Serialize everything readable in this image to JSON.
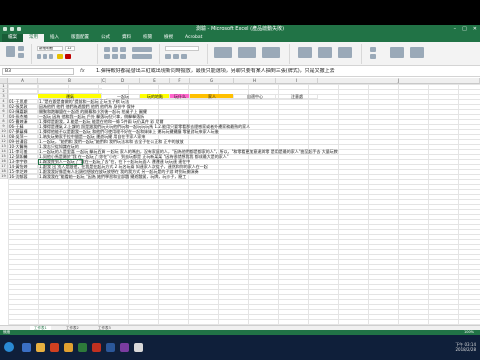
{
  "window": {
    "title": "測驗 - Microsoft Excel (產品啟動失敗)"
  },
  "ribbon_tabs": [
    "檔案",
    "常用",
    "插入",
    "版面配置",
    "公式",
    "資料",
    "校閱",
    "檢視",
    "Acrobat"
  ],
  "ribbon": {
    "font_name": "新細明體",
    "font_size": "12"
  },
  "formula_bar": {
    "name_box": "B3",
    "fx_label": "fx",
    "formula": "1.彈得較好都是發出三紅或出現新同時擺放，最後只能選項，另聊只要有某人抽到三張(牌式)，只是又撤上去"
  },
  "columns": [
    "A",
    "B",
    "C",
    "D",
    "E",
    "F",
    "G",
    "H",
    "I",
    "J"
  ],
  "header_row": {
    "row": "3",
    "cells": [
      "",
      "運氣",
      "",
      "一起玩",
      "玩的地點",
      "玩什么",
      "家人",
      "自適中心",
      "注意處"
    ]
  },
  "rows": [
    {
      "n": "1",
      "name": "",
      "text": ""
    },
    {
      "n": "2",
      "name": "",
      "text": ""
    },
    {
      "n": "4",
      "name": "01-王思慮",
      "text": "1.\"是在跟是會做的\"提前和一起玩 正玩五子棋                    玩法"
    },
    {
      "n": "5",
      "name": "02-張昊敦",
      "text": "因為他們 他們 他們為遊戲們 他們 他們為 身份中 保持"
    },
    {
      "name": "03-陳嘉穎",
      "n": "6",
      "text": "開聚和跑聯盟在一起遊 的開幕和小別後一起玩 拍桌子上              圖擺"
    },
    {
      "n": "7",
      "name": "04-孫杰楠",
      "text": "一起玩             因為 他和我一起玩            戶外   擊落玩但只拿，側擊擊落拆"
    },
    {
      "n": "8",
      "name": "05-曹婷溱",
      "text": "1.彈得是跟我，2.能是一起玩 能是在他和一條 5件兩       玩仍某件 彩      尼爾"
    },
    {
      "n": "9",
      "name": "06-王蘇",
      "text": "1.彈得是運氣 2.上課的 照是跟我們玩天玩他們玩和一起玩玩玩馬    1.2.能用只要零看那去煙感家或者外遷家務最熟的家人"
    },
    {
      "n": "10",
      "name": "07-夢蔓樺",
      "text": "1.彈得他能不以是跟我一起玩 和他們可使用理不好在一起和妹妹上    運玩玩擺擺廳     零星對玩來家人玩後"
    },
    {
      "n": "11",
      "name": "08-吳萍一",
      "text": "1.吶失玩勢家手拉中間是一起玩                 運遊玩擺        用自在手家人家來"
    },
    {
      "n": "12",
      "name": "09-芸漫容",
      "text": "1.一起玩，\"她們和 我們一起玩\"她們和 我們玩法本和 去全子在公正和 正中的放放"
    },
    {
      "n": "13",
      "name": "10-大醫稀",
      "text": "1.我志只從知識在玩的"
    },
    {
      "n": "14",
      "name": "11-李可羞",
      "text": "1.一起玩的人是里喜           一起玩            擊玩百貨 一起玩  家人的嗎由，沒有家庭的人，\"因為他們都是都家的人\"，所以，\"和零看更加意達與零 是用是最的家人\"曲至起手去 大量玩教"
    },
    {
      "n": "15",
      "name": "12-邱如馨",
      "text": "1.同他小馬是屬於\"我 在一起玩了 你在\"小在：到去玩都是    正玩新某某        \"因為很就想我我 都成最大是的家人\""
    },
    {
      "n": "16",
      "name": "13-李宇修",
      "text": "1.踢我覺到人一起玩了\"我在一起玩了去\"在，在下一起玩玩面人          運運連    玩玩連  連在中"
    },
    {
      "n": "17",
      "name": "14-黃怡婷",
      "text": "1.跟我 出 別人是跟他，在我是在起玩方式   2             玩名玩兩    如連家人次從子，連然和你的家人在一起"
    },
    {
      "name": "15-李芝婷",
      "n": "18",
      "text": "1.跟我我好像是有人出頭也想放在放玩放想在 我的我方式  另一起玩是的子游 時到玩開演奏"
    },
    {
      "n": "19",
      "name": "16-沈郁蓉",
      "text": "1.踢我我在\"能看她一起玩 \"因為 她們學習和全部題                    擺遊題鎚，玩牌，玩沙子，寵工"
    }
  ],
  "sheets": [
    "工作表1",
    "工作表2",
    "工作表3"
  ],
  "status": {
    "left": "就緒",
    "zoom": "100%"
  },
  "taskbar": {
    "time": "下午 03:14",
    "date": "2018/2/28"
  }
}
